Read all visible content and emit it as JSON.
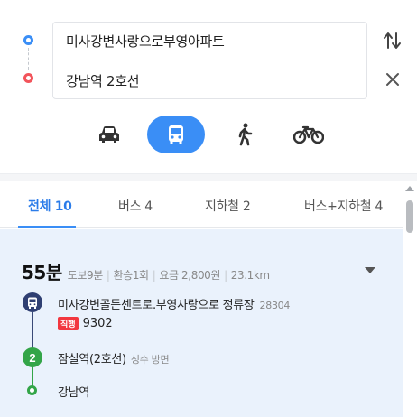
{
  "route": {
    "origin": "미사강변사랑으로부영아파트",
    "destination": "강남역 2호선"
  },
  "modes": [
    {
      "name": "car",
      "icon": "car-icon"
    },
    {
      "name": "transit",
      "icon": "bus-icon",
      "selected": true
    },
    {
      "name": "walk",
      "icon": "walk-icon"
    },
    {
      "name": "bike",
      "icon": "bike-icon"
    }
  ],
  "tabs": [
    {
      "label": "전체 10",
      "active": true
    },
    {
      "label": "버스 4"
    },
    {
      "label": "지하철 2"
    },
    {
      "label": "버스+지하철 4"
    }
  ],
  "result": {
    "duration": "55분",
    "walk": "도보9분",
    "transfers": "환승1회",
    "fare": "요금 2,800원",
    "distance": "23.1km",
    "steps": {
      "bus_stop": "미사강변골든센트로.부영사랑으로 정류장",
      "bus_stop_id": "28304",
      "bus_route_type": "직행",
      "bus_route_number": "9302",
      "subway_line_badge": "2",
      "subway_stop": "잠실역(2호선)",
      "subway_direction": "성수 방면",
      "destination": "강남역"
    }
  },
  "colors": {
    "accent": "#3a8ef6",
    "bus_badge": "#2f3f72",
    "line2": "#33a548",
    "express_tag": "#f2373f",
    "card_bg": "#eaf2fc"
  }
}
